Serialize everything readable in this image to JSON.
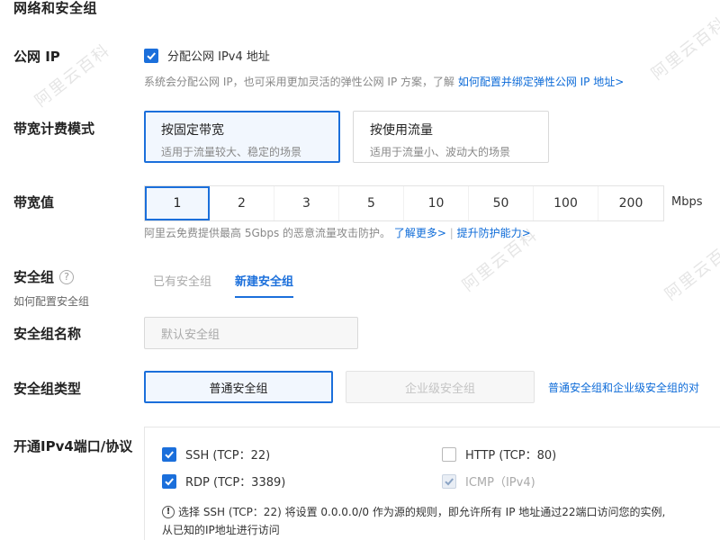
{
  "section": {
    "title": "网络和安全组"
  },
  "public_ip": {
    "label": "公网 IP",
    "checkbox_label": "分配公网 IPv4 地址",
    "checked": true,
    "help_text": "系统会分配公网 IP，也可采用更加灵活的弹性公网 IP 方案，了解",
    "help_link": "如何配置并绑定弹性公网 IP 地址>"
  },
  "billing": {
    "label": "带宽计费模式",
    "options": [
      {
        "title": "按固定带宽",
        "desc": "适用于流量较大、稳定的场景",
        "selected": true
      },
      {
        "title": "按使用流量",
        "desc": "适用于流量小、波动大的场景",
        "selected": false
      }
    ]
  },
  "bandwidth": {
    "label": "带宽值",
    "options": [
      "1",
      "2",
      "3",
      "5",
      "10",
      "50",
      "100",
      "200"
    ],
    "selected": "1",
    "unit": "Mbps",
    "help_text": "阿里云免费提供最高 5Gbps 的恶意流量攻击防护。",
    "link_more": "了解更多>",
    "separator": "|",
    "link_protect": "提升防护能力>"
  },
  "security_group": {
    "label": "安全组",
    "help_icon": "question-circle-icon",
    "sub_label": "如何配置安全组",
    "tabs": [
      {
        "label": "已有安全组",
        "active": false
      },
      {
        "label": "新建安全组",
        "active": true
      }
    ]
  },
  "sg_name": {
    "label": "安全组名称",
    "placeholder": "默认安全组"
  },
  "sg_type": {
    "label": "安全组类型",
    "options": [
      {
        "label": "普通安全组",
        "active": true
      },
      {
        "label": "企业级安全组",
        "active": false
      }
    ],
    "compare_link": "普通安全组和企业级安全组的对"
  },
  "ports": {
    "label": "开通IPv4端口/协议",
    "items": [
      {
        "label": "SSH (TCP：22)",
        "checked": true,
        "disabled": false
      },
      {
        "label": "HTTP (TCP：80)",
        "checked": false,
        "disabled": false
      },
      {
        "label": "RDP (TCP：3389)",
        "checked": true,
        "disabled": false
      },
      {
        "label": "ICMP（IPv4)",
        "checked": true,
        "disabled": true
      }
    ],
    "warning_icon": "info-circle-icon",
    "warning_line1": "选择 SSH (TCP：22) 将设置 0.0.0.0/0 作为源的规则，即允许所有 IP 地址通过22端口访问您的实例,",
    "warning_line2": "从已知的IP地址进行访问"
  },
  "watermark": {
    "text": "阿里云百科"
  },
  "colors": {
    "accent": "#1b6fdb",
    "selected_bg": "#f2f7fe",
    "link": "#0d6bd8"
  }
}
